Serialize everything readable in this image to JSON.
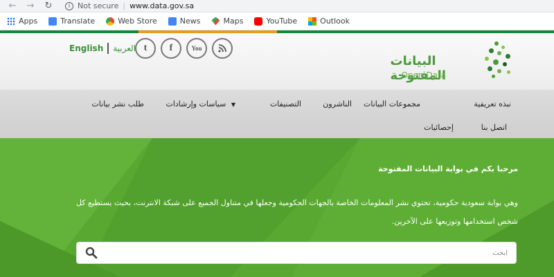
{
  "browser": {
    "security_label": "Not secure",
    "url": "www.data.gov.sa"
  },
  "bookmarks": [
    {
      "label": "Apps",
      "icon": "apps-grid-icon"
    },
    {
      "label": "Translate",
      "icon": "translate-icon"
    },
    {
      "label": "Web Store",
      "icon": "web-store-icon"
    },
    {
      "label": "News",
      "icon": "news-icon"
    },
    {
      "label": "Maps",
      "icon": "maps-icon"
    },
    {
      "label": "YouTube",
      "icon": "youtube-icon"
    },
    {
      "label": "Outlook",
      "icon": "outlook-icon"
    }
  ],
  "colors": {
    "green": "#59a832",
    "brand_green": "#4a9a3a",
    "stripe": [
      "#0f8a3c",
      "#e89b1e",
      "#0f8a3c",
      "#0f8a3c"
    ]
  },
  "header": {
    "lang_en": "English",
    "lang_ar": "العربية",
    "social": [
      "twitter-icon",
      "facebook-icon",
      "youtube-icon",
      "rss-icon"
    ],
    "logo_ar": "البيانات المفتوحة",
    "logo_en": "Open Data"
  },
  "menu": {
    "about": "نبذه تعريفية",
    "datasets": "مجموعات البيانات",
    "publishers": "الناشرون",
    "categories": "التصنيفات",
    "policies": "سياسات وإرشادات",
    "request": "طلب نشر بيانات",
    "contact": "اتصل بنا",
    "stats": "إحصائيات"
  },
  "hero": {
    "title": "مرحبا بكم في بوابة البيانات المفتوحة",
    "text": "وهي بوابة سعودية حكومية، تحتوي نشر المعلومات الخاصة بالجهات الحكومية وجعلها في متناول الجميع على شبكة الانترنت، بحيث يستطيع كل شخص استخدامها وتوزيعها على الآخرين.",
    "search_placeholder": "ابحث"
  }
}
